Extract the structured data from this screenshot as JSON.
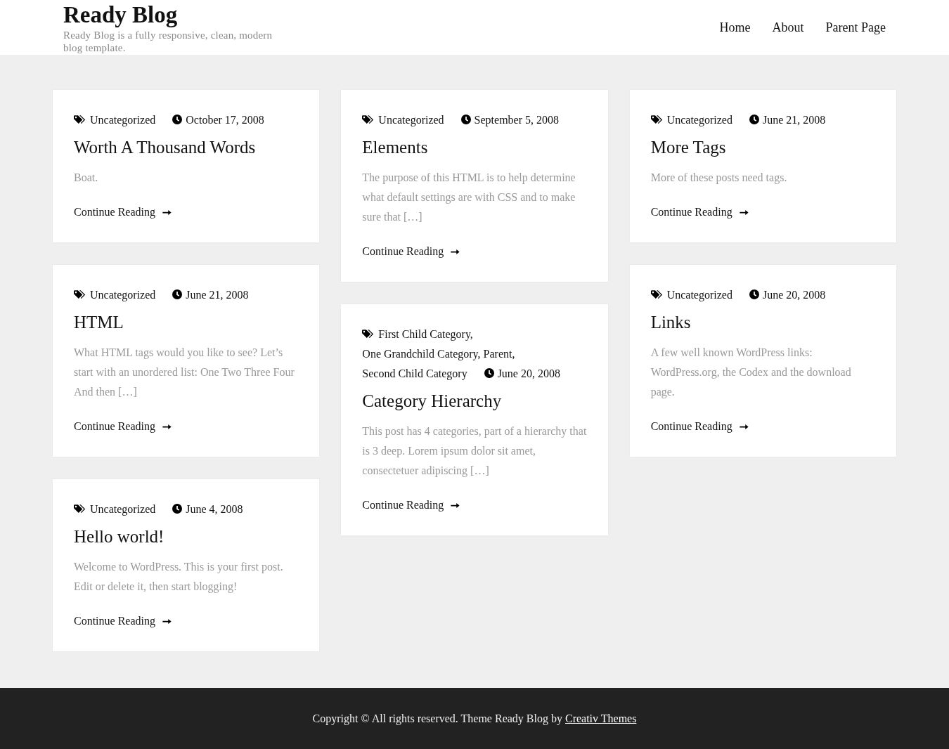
{
  "site": {
    "title": "Ready Blog",
    "tagline": "Ready Blog is a fully responsive, clean, modern blog template."
  },
  "nav": [
    {
      "label": "Home"
    },
    {
      "label": "About"
    },
    {
      "label": "Parent Page"
    }
  ],
  "posts": [
    {
      "categories": [
        "Uncategorized"
      ],
      "date": "October 17, 2008",
      "title": "Worth A Thousand Words",
      "excerpt": "Boat.",
      "more": "Continue Reading"
    },
    {
      "categories": [
        "Uncategorized"
      ],
      "date": "September 5, 2008",
      "title": "Elements",
      "excerpt": "The purpose of this HTML is to help determine what default settings are with CSS and to make sure that […]",
      "more": "Continue Reading"
    },
    {
      "categories": [
        "Uncategorized"
      ],
      "date": "June 21, 2008",
      "title": "More Tags",
      "excerpt": "More of these posts need tags.",
      "more": "Continue Reading"
    },
    {
      "categories": [
        "Uncategorized"
      ],
      "date": "June 21, 2008",
      "title": "HTML",
      "excerpt": "What HTML tags would you like to see? Let’s start with an unordered list: One Two Three Four And then […]",
      "more": "Continue Reading"
    },
    {
      "categories": [
        "First Child Category,",
        "One Grandchild Category,",
        "Parent,",
        "Second Child Category"
      ],
      "date": "June 20, 2008",
      "title": "Category Hierarchy",
      "excerpt": "This post has 4 categories, part of a hierarchy that is 3 deep. Lorem ipsum dolor sit amet, consectetuer adipiscing […]",
      "more": "Continue Reading"
    },
    {
      "categories": [
        "Uncategorized"
      ],
      "date": "June 20, 2008",
      "title": "Links",
      "excerpt": "A few well known WordPress links: WordPress.org, the Codex and the download page.",
      "more": "Continue Reading"
    },
    {
      "categories": [
        "Uncategorized"
      ],
      "date": "June 4, 2008",
      "title": "Hello world!",
      "excerpt": "Welcome to WordPress. This is your first post. Edit or delete it, then start blogging!",
      "more": "Continue Reading"
    }
  ],
  "footer": {
    "text": "Copyright © All rights reserved. Theme Ready Blog by",
    "link": "Creativ Themes"
  }
}
